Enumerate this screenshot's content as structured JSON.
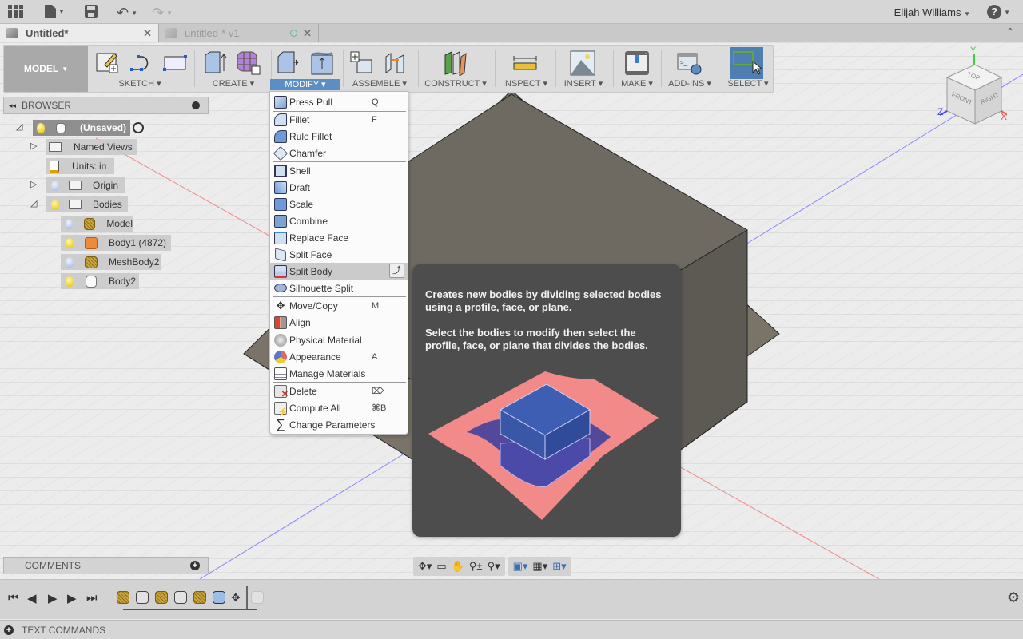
{
  "topbar": {
    "user_name": "Elijah Williams",
    "icons": [
      "apps-grid-icon",
      "file-icon",
      "save-icon",
      "undo-icon",
      "redo-icon",
      "help-icon"
    ]
  },
  "tabs": [
    {
      "label": "Untitled*",
      "active": true
    },
    {
      "label": "untitled-* v1",
      "active": false
    }
  ],
  "ribbon": {
    "workspace": "MODEL",
    "groups": [
      {
        "label": "SKETCH"
      },
      {
        "label": "CREATE"
      },
      {
        "label": "MODIFY",
        "active": true
      },
      {
        "label": "ASSEMBLE"
      },
      {
        "label": "CONSTRUCT"
      },
      {
        "label": "INSPECT"
      },
      {
        "label": "INSERT"
      },
      {
        "label": "MAKE"
      },
      {
        "label": "ADD-INS"
      },
      {
        "label": "SELECT"
      }
    ]
  },
  "browser": {
    "title": "BROWSER",
    "root": "(Unsaved)",
    "items": [
      {
        "label": "Named Views"
      },
      {
        "label": "Units: in"
      },
      {
        "label": "Origin"
      },
      {
        "label": "Bodies"
      }
    ],
    "bodies": [
      {
        "label": "Model",
        "light": "off",
        "type": "mesh"
      },
      {
        "label": "Body1 (4872)",
        "light": "on",
        "type": "body-orange"
      },
      {
        "label": "MeshBody2",
        "light": "off",
        "type": "mesh"
      },
      {
        "label": "Body2",
        "light": "on",
        "type": "body-white"
      }
    ]
  },
  "modify_menu": {
    "items": [
      {
        "label": "Press Pull",
        "shortcut": "Q"
      },
      {
        "label": "Fillet",
        "shortcut": "F"
      },
      {
        "label": "Rule Fillet",
        "shortcut": ""
      },
      {
        "label": "Chamfer",
        "shortcut": ""
      },
      {
        "label": "Shell",
        "shortcut": ""
      },
      {
        "label": "Draft",
        "shortcut": ""
      },
      {
        "label": "Scale",
        "shortcut": ""
      },
      {
        "label": "Combine",
        "shortcut": ""
      },
      {
        "label": "Replace Face",
        "shortcut": ""
      },
      {
        "label": "Split Face",
        "shortcut": ""
      },
      {
        "label": "Split Body",
        "shortcut": "",
        "highlighted": true
      },
      {
        "label": "Silhouette Split",
        "shortcut": ""
      },
      {
        "label": "Move/Copy",
        "shortcut": "M"
      },
      {
        "label": "Align",
        "shortcut": ""
      },
      {
        "label": "Physical Material",
        "shortcut": ""
      },
      {
        "label": "Appearance",
        "shortcut": "A"
      },
      {
        "label": "Manage Materials",
        "shortcut": ""
      },
      {
        "label": "Delete",
        "shortcut": "⌦"
      },
      {
        "label": "Compute All",
        "shortcut": "⌘B"
      },
      {
        "label": "Change Parameters",
        "shortcut": ""
      }
    ]
  },
  "tooltip": {
    "text1": "Creates new bodies by dividing selected bodies using a profile, face, or plane.",
    "text2": "Select the bodies to modify then select the profile, face, or plane that divides the bodies."
  },
  "viewcube": {
    "top": "TOP",
    "front": "FRONT",
    "right": "RIGHT",
    "x": "X",
    "y": "Y",
    "z": "Z"
  },
  "comments": {
    "title": "COMMENTS"
  },
  "text_commands": {
    "title": "TEXT COMMANDS"
  },
  "colors": {
    "accent": "#5b8ec4",
    "tooltip_bg": "#4d4d4d",
    "model_bg": "#a9a9a9"
  }
}
